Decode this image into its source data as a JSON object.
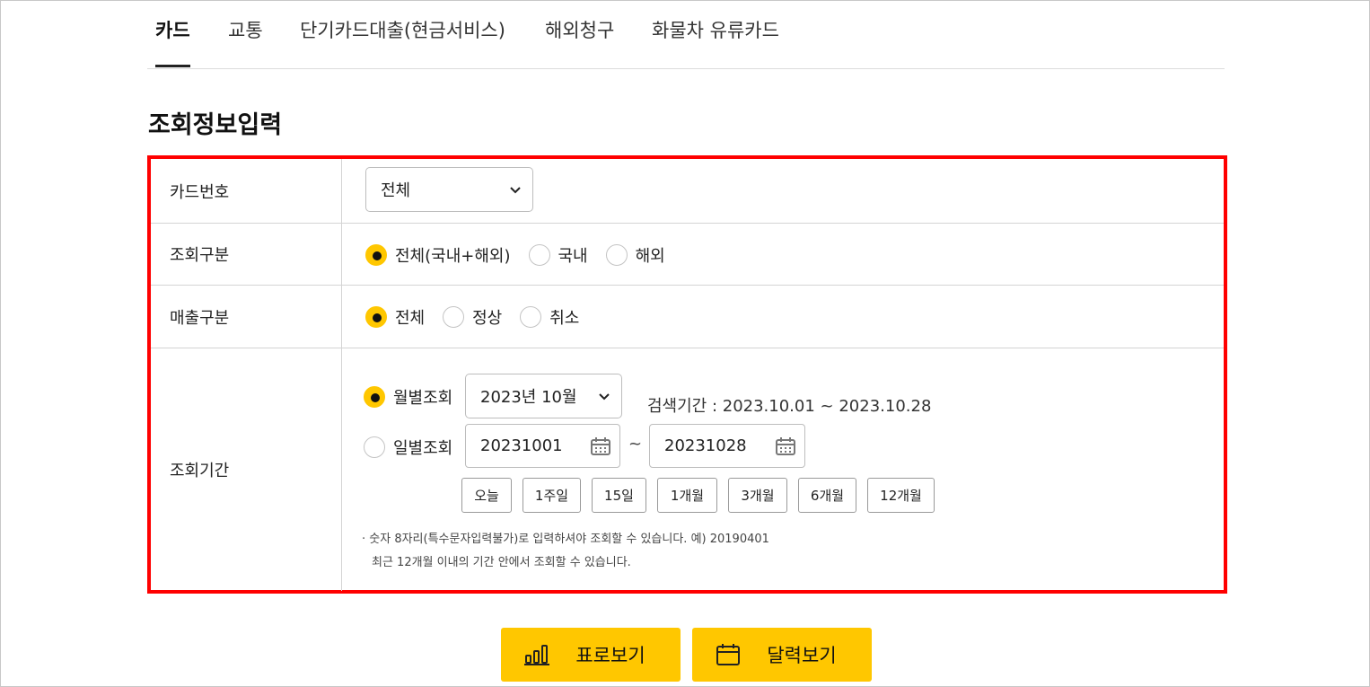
{
  "tabs": [
    {
      "label": "카드",
      "active": true
    },
    {
      "label": "교통",
      "active": false
    },
    {
      "label": "단기카드대출(현금서비스)",
      "active": false
    },
    {
      "label": "해외청구",
      "active": false
    },
    {
      "label": "화물차 유류카드",
      "active": false
    }
  ],
  "page_title": "조회정보입력",
  "form": {
    "card_number": {
      "label": "카드번호",
      "selected": "전체"
    },
    "inquiry_type": {
      "label": "조회구분",
      "options": [
        "전체(국내+해외)",
        "국내",
        "해외"
      ],
      "selected_index": 0
    },
    "sales_type": {
      "label": "매출구분",
      "options": [
        "전체",
        "정상",
        "취소"
      ],
      "selected_index": 0
    },
    "period": {
      "label": "조회기간",
      "monthly_label": "월별조회",
      "monthly_selected": true,
      "month_value": "2023년 10월",
      "search_range_text": "검색기간 : 2023.10.01 ~ 2023.10.28",
      "daily_label": "일별조회",
      "date_from": "20231001",
      "tilde": "~",
      "date_to": "20231028",
      "quick_buttons": [
        "오늘",
        "1주일",
        "15일",
        "1개월",
        "3개월",
        "6개월",
        "12개월"
      ],
      "note_line1": "· 숫자 8자리(특수문자입력불가)로 입력하셔야 조회할 수 있습니다. 예) 20190401",
      "note_line2": "최근 12개월 이내의 기간 안에서 조회할 수 있습니다."
    }
  },
  "actions": {
    "table_view_label": "표로보기",
    "calendar_view_label": "달력보기"
  },
  "colors": {
    "accent": "#ffc700",
    "highlight_border": "#ff0000"
  }
}
